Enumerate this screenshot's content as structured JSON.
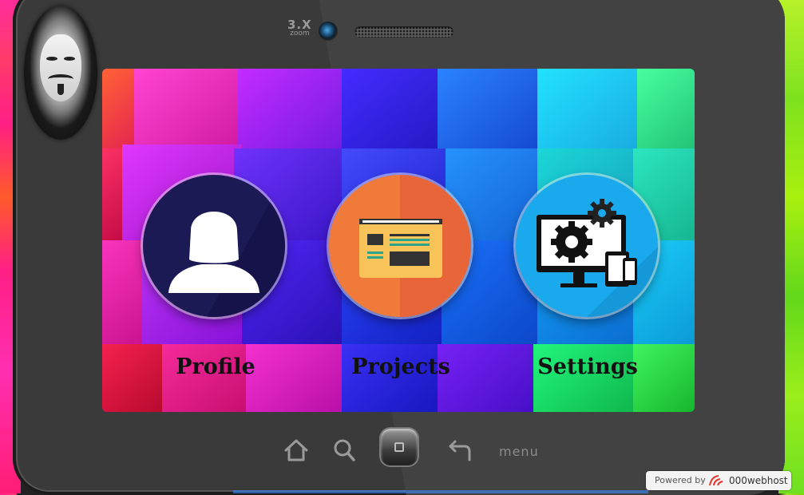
{
  "device": {
    "zoom_value": "3.X",
    "zoom_caption": "zoom"
  },
  "avatar": {
    "icon": "anonymous-mask-icon"
  },
  "apps": [
    {
      "label": "Profile",
      "icon": "user-silhouette-icon",
      "color": "#1c1a55"
    },
    {
      "label": "Projects",
      "icon": "browser-window-icon",
      "color": "#f07a3a"
    },
    {
      "label": "Settings",
      "icon": "devices-gears-icon",
      "color": "#19a9ec"
    }
  ],
  "nav": {
    "home_icon": "house-icon",
    "search_icon": "search-icon",
    "center_icon": "home-button-icon",
    "back_icon": "back-arrow-icon",
    "menu_label": "menu"
  },
  "footer": {
    "powered_label": "Powered by",
    "host_name": "000webhost"
  }
}
